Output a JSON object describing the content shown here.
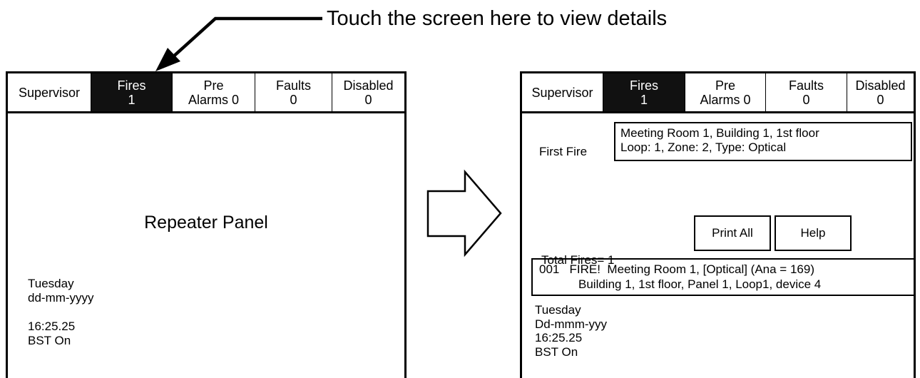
{
  "caption": "Touch the screen here to view details",
  "left_panel": {
    "tabs": [
      {
        "label1": "Supervisor",
        "label2": ""
      },
      {
        "label1": "Fires",
        "label2": "1"
      },
      {
        "label1": "Pre",
        "label2": "Alarms 0"
      },
      {
        "label1": "Faults",
        "label2": "0"
      },
      {
        "label1": "Disabled",
        "label2": "0"
      }
    ],
    "title": "Repeater Panel",
    "day": "Tuesday",
    "date": "dd-mm-yyyy",
    "time": "16:25.25",
    "bst": "BST On"
  },
  "right_panel": {
    "tabs": [
      {
        "label1": "Supervisor",
        "label2": ""
      },
      {
        "label1": "Fires",
        "label2": "1"
      },
      {
        "label1": "Pre",
        "label2": "Alarms 0"
      },
      {
        "label1": "Faults",
        "label2": "0"
      },
      {
        "label1": "Disabled",
        "label2": "0"
      }
    ],
    "first_fire_label": "First Fire",
    "first_fire_line1": "Meeting Room 1, Building 1, 1st floor",
    "first_fire_line2": "Loop: 1, Zone: 2, Type: Optical",
    "total_fires": "Total Fires= 1",
    "print_all": "Print All",
    "help": "Help",
    "event_line1": "001   FIRE!  Meeting Room 1, [Optical] (Ana = 169)",
    "event_line2": "Building 1, 1st floor, Panel 1, Loop1, device 4",
    "day": "Tuesday",
    "date": "Dd-mmm-yyy",
    "time": "16:25.25",
    "bst": "BST On"
  }
}
